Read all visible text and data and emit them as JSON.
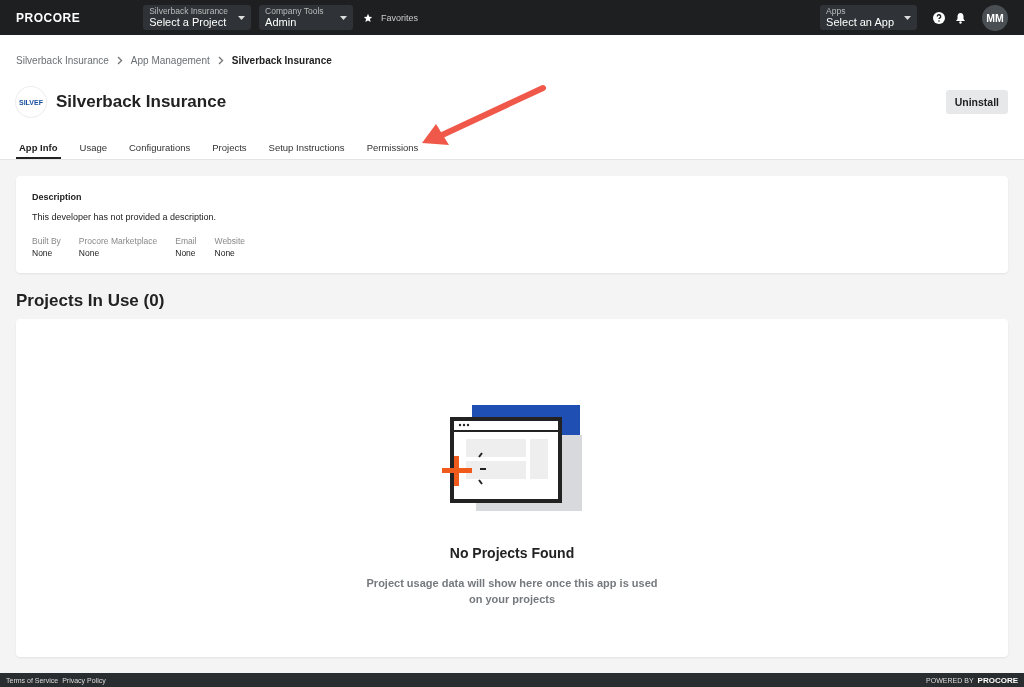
{
  "topbar": {
    "logo": "PROCORE",
    "selectors": [
      {
        "label": "Silverback Insurance",
        "value": "Select a Project"
      },
      {
        "label": "Company Tools",
        "value": "Admin"
      }
    ],
    "favorites": "Favorites",
    "apps": {
      "label": "Apps",
      "value": "Select an App"
    },
    "avatar": "MM"
  },
  "breadcrumbs": [
    {
      "label": "Silverback Insurance",
      "current": false
    },
    {
      "label": "App Management",
      "current": false
    },
    {
      "label": "Silverback Insurance",
      "current": true
    }
  ],
  "app": {
    "logo_text": "SILVEF",
    "title": "Silverback Insurance",
    "action": "Uninstall"
  },
  "tabs": [
    {
      "label": "App Info",
      "selected": true
    },
    {
      "label": "Usage",
      "selected": false
    },
    {
      "label": "Configurations",
      "selected": false
    },
    {
      "label": "Projects",
      "selected": false
    },
    {
      "label": "Setup Instructions",
      "selected": false
    },
    {
      "label": "Permissions",
      "selected": false
    }
  ],
  "description": {
    "heading": "Description",
    "text": "This developer has not provided a description.",
    "fields": [
      {
        "label": "Built By",
        "value": "None"
      },
      {
        "label": "Procore Marketplace",
        "value": "None"
      },
      {
        "label": "Email",
        "value": "None"
      },
      {
        "label": "Website",
        "value": "None"
      }
    ]
  },
  "projects": {
    "heading": "Projects In Use (0)",
    "empty_title": "No Projects Found",
    "empty_text": "Project usage data will show here once this app is used on your projects"
  },
  "footer": {
    "links": [
      "Terms of Service",
      "Privacy Policy"
    ],
    "powered_by": "POWERED BY",
    "logo": "PROCORE"
  }
}
